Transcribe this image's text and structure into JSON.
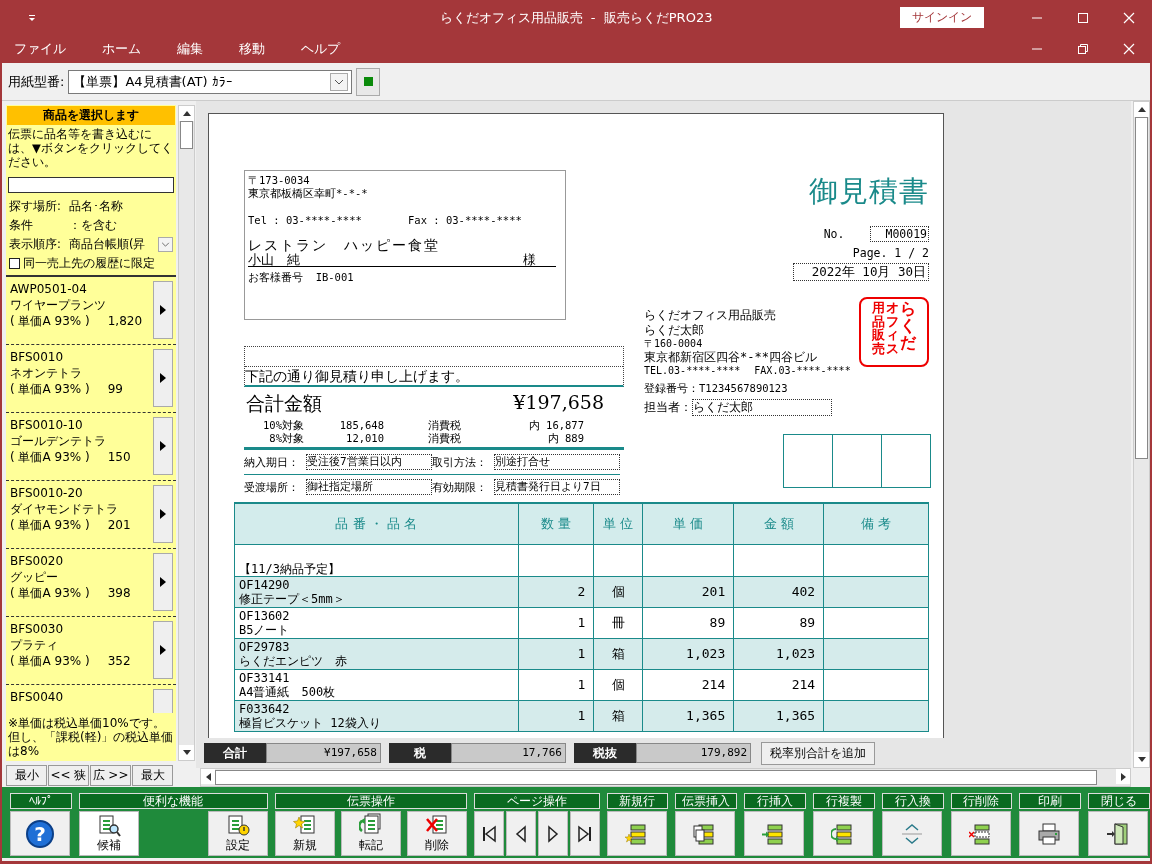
{
  "window": {
    "title": "らくだオフィス用品販売  -  販売らくだPRO23",
    "signin": "サインイン"
  },
  "menu": [
    "ファイル",
    "ホーム",
    "編集",
    "移動",
    "ヘルプ"
  ],
  "form_selector": {
    "label": "用紙型番:",
    "value": "【単票】A4見積書(AT) ｶﾗｰ"
  },
  "sidebar": {
    "header": "商品を選択します",
    "instructions": "伝票に品名等を書き込むには、▼ボタンをクリックしてください。",
    "filters": [
      {
        "label": "探す場所:",
        "value": "品名･名称"
      },
      {
        "label": "条件",
        "value": "：を含む"
      }
    ],
    "sort": {
      "label": "表示順序:",
      "value": "商品台帳順(昇"
    },
    "history_only": {
      "label": "同一売上先の履歴に限定",
      "checked": false
    },
    "items": [
      {
        "code": "AWP0501-04",
        "name": "ワイヤープランツ",
        "price_label": "( 単価A 93% )",
        "price": "1,820"
      },
      {
        "code": "BFS0010",
        "name": "ネオンテトラ",
        "price_label": "( 単価A 93% )",
        "price": "99"
      },
      {
        "code": "BFS0010-10",
        "name": "ゴールデンテトラ",
        "price_label": "( 単価A 93% )",
        "price": "150"
      },
      {
        "code": "BFS0010-20",
        "name": "ダイヤモンドテトラ",
        "price_label": "( 単価A 93% )",
        "price": "201"
      },
      {
        "code": "BFS0020",
        "name": "グッピー",
        "price_label": "( 単価A 93% )",
        "price": "398"
      },
      {
        "code": "BFS0030",
        "name": "プラティ",
        "price_label": "( 単価A 93% )",
        "price": "352"
      },
      {
        "code": "BFS0040"
      }
    ],
    "note": "※単価は税込単価10%です。但し、「課税(軽)」の税込単価は8%",
    "nav_buttons": [
      "最小",
      "<< 狭",
      "広 >>",
      "最大"
    ]
  },
  "document": {
    "customer": {
      "postal": "〒173-0034",
      "address": "東京都板橋区幸町*-*-*",
      "tel": "Tel : 03-****-****",
      "fax": "Fax : 03-****-****",
      "company": "レストラン　ハッピー食堂",
      "person": "小山　純",
      "honorific": "様",
      "number_label": "お客様番号",
      "number": "IB-001"
    },
    "title": "御見積書",
    "no_label": "No.",
    "no": "M00019",
    "page": "Page. 1 / 2",
    "date": "2022年 10月 30日",
    "message": "下記の通り御見積り申し上げます。",
    "total_label": "合計金額",
    "total": "¥197,658",
    "tax_rows": [
      {
        "label": "10%対象",
        "amount": "185,648",
        "tax_label": "消費税",
        "tax": "内 16,877"
      },
      {
        "label": "8%対象",
        "amount": "12,010",
        "tax_label": "消費税",
        "tax": "内 889"
      }
    ],
    "terms": [
      {
        "label": "納入期日：",
        "value": "受注後7営業日以内"
      },
      {
        "label": "取引方法：",
        "value": "別途打合せ"
      },
      {
        "label": "受渡場所：",
        "value": "御社指定場所"
      },
      {
        "label": "有効期限：",
        "value": "見積書発行日より7日"
      }
    ],
    "issuer": {
      "company": "らくだオフィス用品販売",
      "person": "らくだ太郎",
      "postal": "〒160-0004",
      "address": "東京都新宿区四谷*-**四谷ビル",
      "tel": "TEL.03-****-****",
      "fax": "FAX.03-****-****",
      "registration": "登録番号：T1234567890123",
      "staff_label": "担当者：",
      "staff": "らくだ太郎"
    },
    "stamp": [
      "用品販売",
      "オフィス",
      "らくだ"
    ],
    "table": {
      "columns": [
        "品 番 ・ 品 名",
        "数 量",
        "単 位",
        "単 価",
        "金 額",
        "備 考"
      ],
      "rows": [
        {
          "kind": "note",
          "text": "【11/3納品予定】"
        },
        {
          "kind": "item",
          "code": "OF14290",
          "name": "修正テープ＜5mm＞",
          "qty": "2",
          "unit": "個",
          "price": "201",
          "amount": "402"
        },
        {
          "kind": "item",
          "code": "OF13602",
          "name": "B5ノート",
          "qty": "1",
          "unit": "冊",
          "price": "89",
          "amount": "89"
        },
        {
          "kind": "item",
          "code": "OF29783",
          "name": "らくだエンピツ　赤",
          "qty": "1",
          "unit": "箱",
          "price": "1,023",
          "amount": "1,023"
        },
        {
          "kind": "item",
          "code": "OF33141",
          "name": "A4普通紙　500枚",
          "qty": "1",
          "unit": "個",
          "price": "214",
          "amount": "214"
        },
        {
          "kind": "item",
          "code": "F033642",
          "name": "極旨ビスケット 12袋入り",
          "qty": "1",
          "unit": "箱",
          "price": "1,365",
          "amount": "1,365"
        }
      ]
    }
  },
  "totals": [
    {
      "label": "合計",
      "value": "¥197,658"
    },
    {
      "label": "税",
      "value": "17,766"
    },
    {
      "label": "税抜",
      "value": "179,892"
    }
  ],
  "add_tax_button": "税率別合計を追加",
  "toolbar_groups": [
    {
      "title": "ﾍﾙﾌﾟ",
      "buttons": [
        {
          "kind": "help",
          "glyph": "?"
        }
      ]
    },
    {
      "title": "便利な機能",
      "buttons": [
        {
          "kind": "candidates",
          "label": "候補",
          "selected": true
        },
        {
          "kind": "settings",
          "label": "設定",
          "selected": false
        }
      ]
    },
    {
      "title": "伝票操作",
      "buttons": [
        {
          "kind": "new",
          "label": "新規"
        },
        {
          "kind": "transfer",
          "label": "転記"
        },
        {
          "kind": "delete",
          "label": "削除"
        }
      ]
    },
    {
      "title": "ページ操作",
      "buttons": [
        {
          "kind": "first"
        },
        {
          "kind": "prev"
        },
        {
          "kind": "next"
        },
        {
          "kind": "last"
        }
      ]
    },
    {
      "title": "新規行",
      "buttons": [
        {
          "kind": "row-new"
        }
      ]
    },
    {
      "title": "伝票挿入",
      "buttons": [
        {
          "kind": "slip-insert"
        }
      ]
    },
    {
      "title": "行挿入",
      "buttons": [
        {
          "kind": "row-insert"
        }
      ]
    },
    {
      "title": "行複製",
      "buttons": [
        {
          "kind": "row-copy"
        }
      ]
    },
    {
      "title": "行入換",
      "buttons": [
        {
          "kind": "row-swap"
        }
      ]
    },
    {
      "title": "行削除",
      "buttons": [
        {
          "kind": "row-delete"
        }
      ]
    },
    {
      "title": "印刷",
      "buttons": [
        {
          "kind": "print"
        }
      ]
    },
    {
      "title": "閉じる",
      "buttons": [
        {
          "kind": "close"
        }
      ]
    }
  ]
}
